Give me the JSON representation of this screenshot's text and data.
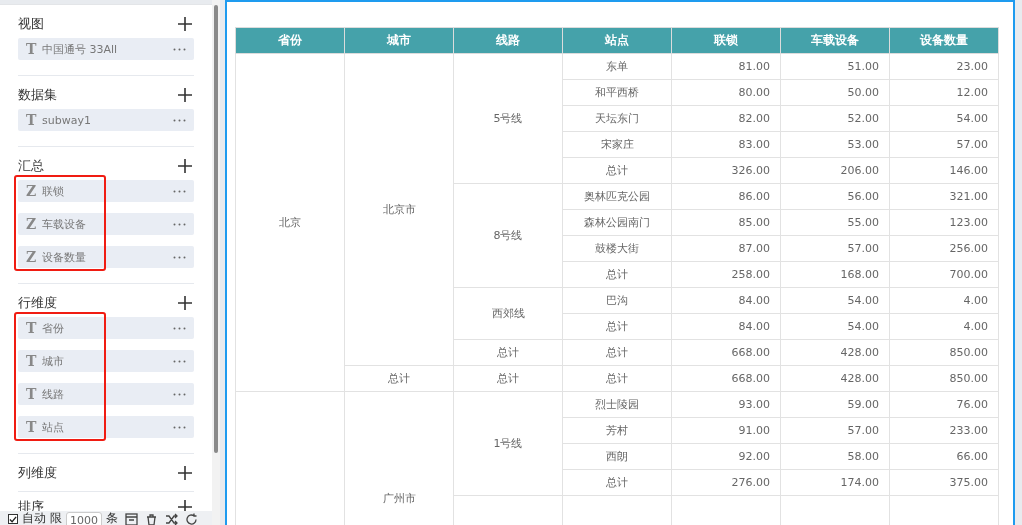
{
  "sidebar": {
    "sections": [
      {
        "title": "视图",
        "items": [
          {
            "type_glyph": "T",
            "label": "中国通号 33All"
          }
        ]
      },
      {
        "title": "数据集",
        "items": [
          {
            "type_glyph": "T",
            "label": "subway1"
          }
        ]
      },
      {
        "title": "汇总",
        "highlighted": true,
        "items": [
          {
            "type_glyph": "Z",
            "label": "联锁"
          },
          {
            "type_glyph": "Z",
            "label": "车载设备"
          },
          {
            "type_glyph": "Z",
            "label": "设备数量"
          }
        ]
      },
      {
        "title": "行维度",
        "highlighted": true,
        "items": [
          {
            "type_glyph": "T",
            "label": "省份"
          },
          {
            "type_glyph": "T",
            "label": "城市"
          },
          {
            "type_glyph": "T",
            "label": "线路"
          },
          {
            "type_glyph": "T",
            "label": "站点"
          }
        ]
      },
      {
        "title": "列维度"
      },
      {
        "title": "排序"
      }
    ]
  },
  "toolbar": {
    "auto": {
      "label": "自动",
      "checked": true
    },
    "limit_label": "限",
    "limit_value": "1000",
    "unit": "条"
  },
  "table": {
    "columns": [
      "省份",
      "城市",
      "线路",
      "站点",
      "联锁",
      "车载设备",
      "设备数量"
    ],
    "provinces": [
      {
        "name": "北京",
        "cities": [
          {
            "name": "北京市",
            "lines": [
              {
                "name": "5号线",
                "stations": [
                  {
                    "name": "东单",
                    "values": [
                      "81.00",
                      "51.00",
                      "23.00"
                    ]
                  },
                  {
                    "name": "和平西桥",
                    "values": [
                      "80.00",
                      "50.00",
                      "12.00"
                    ]
                  },
                  {
                    "name": "天坛东门",
                    "values": [
                      "82.00",
                      "52.00",
                      "54.00"
                    ]
                  },
                  {
                    "name": "宋家庄",
                    "values": [
                      "83.00",
                      "53.00",
                      "57.00"
                    ]
                  },
                  {
                    "name": "总计",
                    "values": [
                      "326.00",
                      "206.00",
                      "146.00"
                    ]
                  }
                ]
              },
              {
                "name": "8号线",
                "stations": [
                  {
                    "name": "奥林匹克公园",
                    "values": [
                      "86.00",
                      "56.00",
                      "321.00"
                    ]
                  },
                  {
                    "name": "森林公园南门",
                    "values": [
                      "85.00",
                      "55.00",
                      "123.00"
                    ]
                  },
                  {
                    "name": "鼓楼大街",
                    "values": [
                      "87.00",
                      "57.00",
                      "256.00"
                    ]
                  },
                  {
                    "name": "总计",
                    "values": [
                      "258.00",
                      "168.00",
                      "700.00"
                    ]
                  }
                ]
              },
              {
                "name": "西郊线",
                "stations": [
                  {
                    "name": "巴沟",
                    "values": [
                      "84.00",
                      "54.00",
                      "4.00"
                    ]
                  },
                  {
                    "name": "总计",
                    "values": [
                      "84.00",
                      "54.00",
                      "4.00"
                    ]
                  }
                ]
              },
              {
                "name": "总计",
                "stations": [
                  {
                    "name": "总计",
                    "values": [
                      "668.00",
                      "428.00",
                      "850.00"
                    ]
                  }
                ]
              }
            ]
          },
          {
            "name": "总计",
            "lines": [
              {
                "name": "总计",
                "stations": [
                  {
                    "name": "总计",
                    "values": [
                      "668.00",
                      "428.00",
                      "850.00"
                    ]
                  }
                ]
              }
            ]
          }
        ]
      },
      {
        "cities": [
          {
            "name": "广州市",
            "lines": [
              {
                "name": "1号线",
                "stations": [
                  {
                    "name": "烈士陵园",
                    "values": [
                      "93.00",
                      "59.00",
                      "76.00"
                    ]
                  },
                  {
                    "name": "芳村",
                    "values": [
                      "91.00",
                      "57.00",
                      "233.00"
                    ]
                  },
                  {
                    "name": "西朗",
                    "values": [
                      "92.00",
                      "58.00",
                      "66.00"
                    ]
                  },
                  {
                    "name": "总计",
                    "values": [
                      "276.00",
                      "174.00",
                      "375.00"
                    ]
                  }
                ]
              }
            ]
          }
        ]
      }
    ]
  }
}
